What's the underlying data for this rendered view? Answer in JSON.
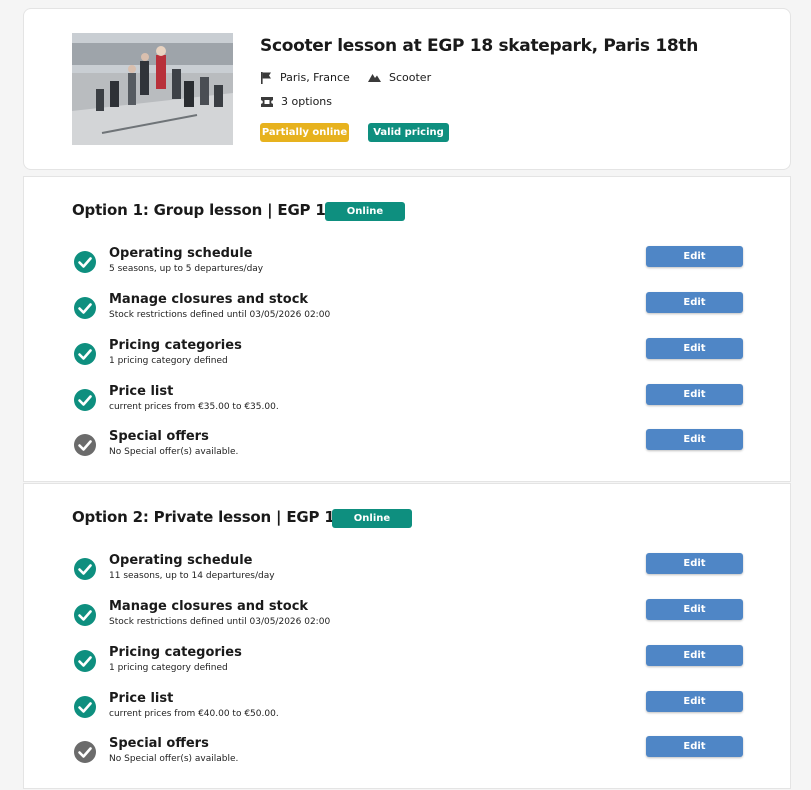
{
  "product": {
    "title": "Scooter lesson at EGP 18 skatepark, Paris 18th",
    "location": "Paris, France",
    "category": "Scooter",
    "options_count": "3 options",
    "badges": {
      "partially_online": "Partially online",
      "valid_pricing": "Valid pricing"
    }
  },
  "options": [
    {
      "title": "Option 1: Group lesson | EGP 18",
      "status": "Online",
      "rows": [
        {
          "title": "Operating schedule",
          "subtitle": "5 seasons, up to 5 departures/day",
          "status": "complete",
          "button": "Edit"
        },
        {
          "title": "Manage closures and stock",
          "subtitle": "Stock restrictions defined until 03/05/2026 02:00",
          "status": "complete",
          "button": "Edit"
        },
        {
          "title": "Pricing categories",
          "subtitle": "1 pricing category defined",
          "status": "complete",
          "button": "Edit"
        },
        {
          "title": "Price list",
          "subtitle": "current prices from €35.00 to €35.00.",
          "status": "complete",
          "button": "Edit"
        },
        {
          "title": "Special offers",
          "subtitle": "No Special offer(s) available.",
          "status": "neutral",
          "button": "Edit"
        }
      ]
    },
    {
      "title": "Option 2: Private lesson | EGP 18",
      "status": "Online",
      "rows": [
        {
          "title": "Operating schedule",
          "subtitle": "11 seasons, up to 14 departures/day",
          "status": "complete",
          "button": "Edit"
        },
        {
          "title": "Manage closures and stock",
          "subtitle": "Stock restrictions defined until 03/05/2026 02:00",
          "status": "complete",
          "button": "Edit"
        },
        {
          "title": "Pricing categories",
          "subtitle": "1 pricing category defined",
          "status": "complete",
          "button": "Edit"
        },
        {
          "title": "Price list",
          "subtitle": "current prices from €40.00 to €50.00.",
          "status": "complete",
          "button": "Edit"
        },
        {
          "title": "Special offers",
          "subtitle": "No Special offer(s) available.",
          "status": "neutral",
          "button": "Edit"
        }
      ]
    }
  ],
  "icons": {
    "location": "flag-icon",
    "category": "mountain-icon",
    "options": "ticket-icon",
    "complete": "check-circle-icon",
    "neutral": "check-circle-grey-icon"
  },
  "colors": {
    "teal": "#0e8f7f",
    "yellow": "#e7b21e",
    "edit_button": "#4f86c6",
    "check_complete": "#0e8f7f",
    "check_neutral": "#6b6b6b"
  }
}
